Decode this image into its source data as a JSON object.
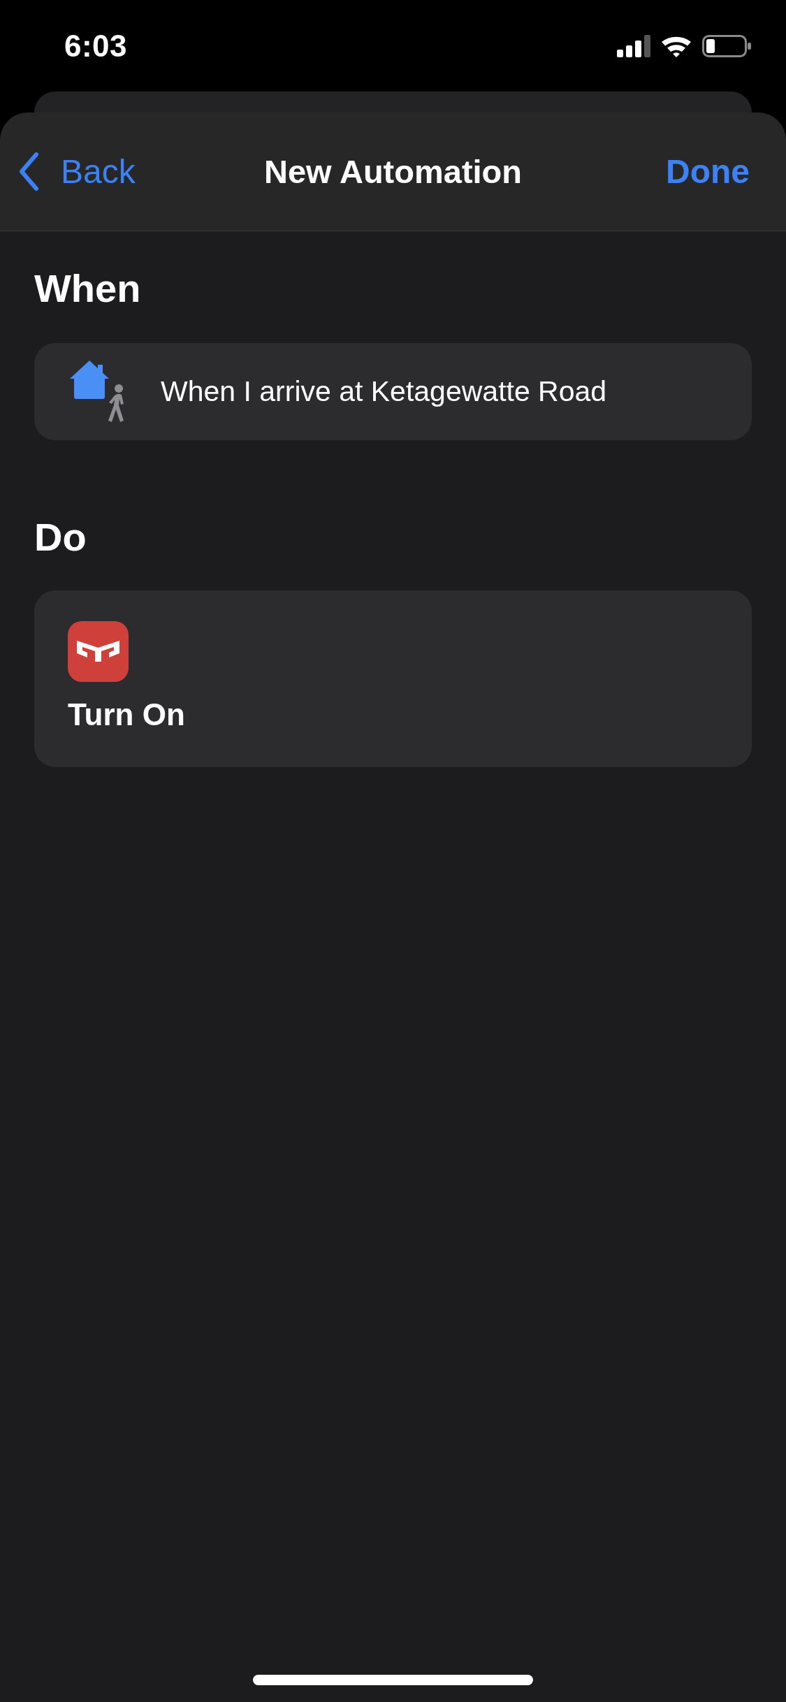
{
  "status_bar": {
    "time": "6:03"
  },
  "nav_bar": {
    "back": "Back",
    "title": "New Automation",
    "done": "Done"
  },
  "sections": [
    {
      "kind": "trigger",
      "heading": "When",
      "text": "When I arrive at Ketagewatte Road"
    },
    {
      "kind": "action",
      "heading": "Do",
      "text": "Turn On"
    }
  ]
}
